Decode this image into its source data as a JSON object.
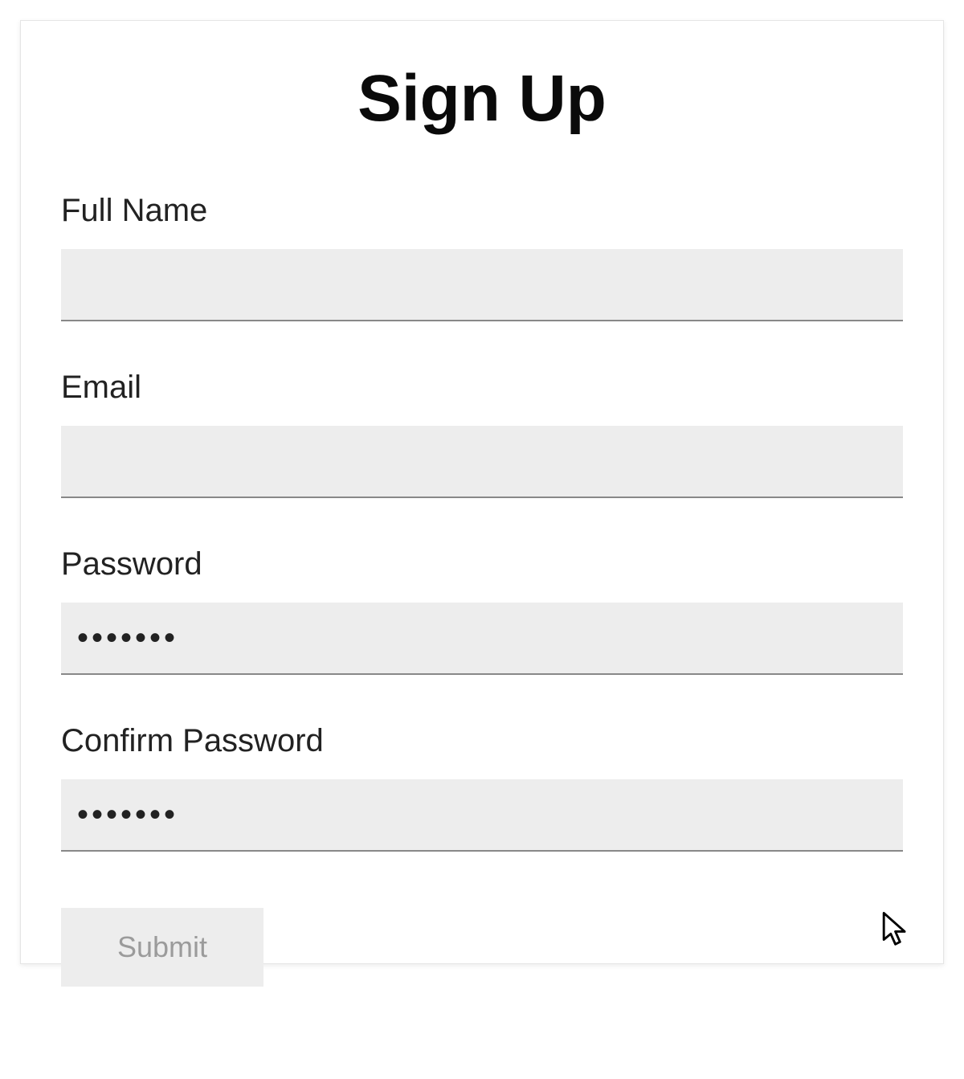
{
  "form": {
    "title": "Sign Up",
    "fields": {
      "fullname": {
        "label": "Full Name",
        "value": ""
      },
      "email": {
        "label": "Email",
        "value": ""
      },
      "password": {
        "label": "Password",
        "value": "•••••••"
      },
      "confirm": {
        "label": "Confirm Password",
        "value": "•••••••"
      }
    },
    "submit_label": "Submit"
  }
}
